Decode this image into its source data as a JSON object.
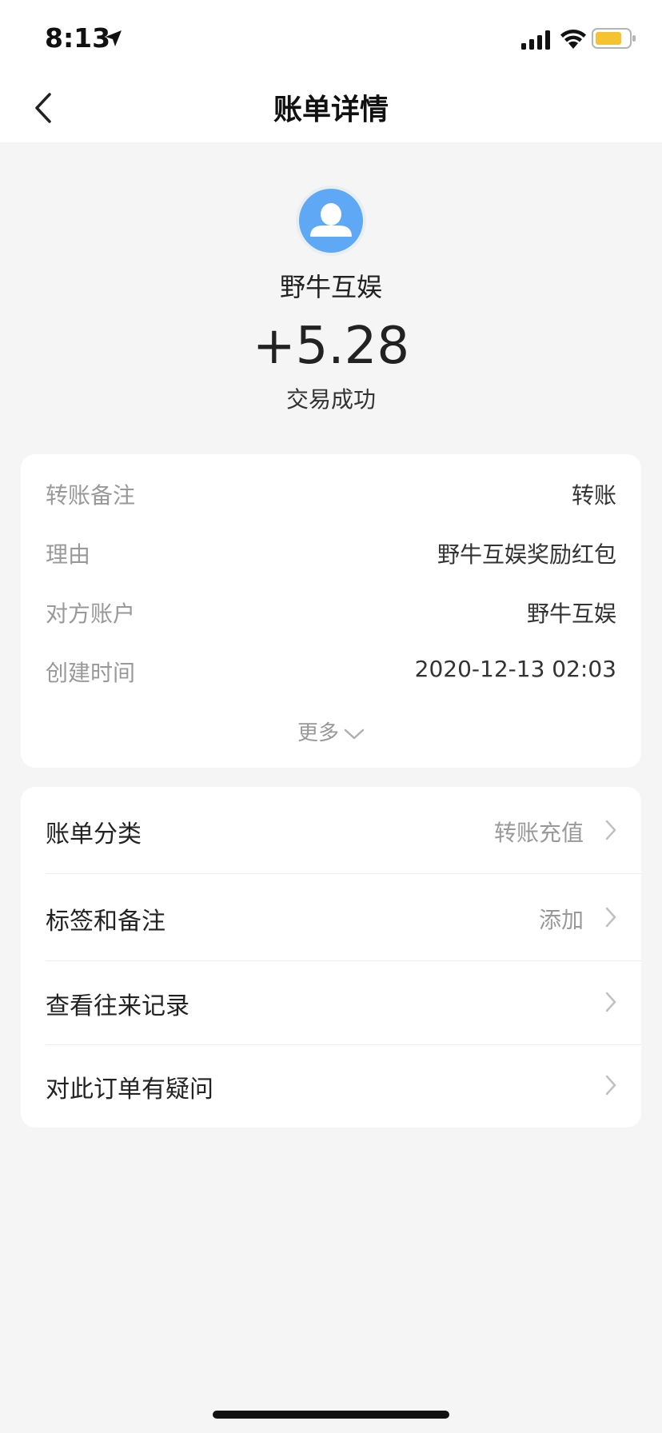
{
  "status_bar": {
    "time": "8:13",
    "location_icon": "location-arrow-icon",
    "signal_icon": "cellular-signal-icon",
    "wifi_icon": "wifi-icon",
    "battery_icon": "battery-icon",
    "battery_color": "#f5c230"
  },
  "nav": {
    "title": "账单详情",
    "back_icon": "chevron-left-icon"
  },
  "summary": {
    "avatar_icon": "user-avatar-icon",
    "avatar_color": "#5ea8f5",
    "payee": "野牛互娱",
    "amount": "+5.28",
    "status": "交易成功"
  },
  "details": {
    "rows": [
      {
        "label": "转账备注",
        "value": "转账"
      },
      {
        "label": "理由",
        "value": "野牛互娱奖励红包"
      },
      {
        "label": "对方账户",
        "value": "野牛互娱"
      },
      {
        "label": "创建时间",
        "value": "2020-12-13 02:03"
      }
    ],
    "more_label": "更多"
  },
  "menu": {
    "items": [
      {
        "label": "账单分类",
        "value": "转账充值"
      },
      {
        "label": "标签和备注",
        "value": "添加"
      },
      {
        "label": "查看往来记录",
        "value": ""
      },
      {
        "label": "对此订单有疑问",
        "value": ""
      }
    ]
  }
}
